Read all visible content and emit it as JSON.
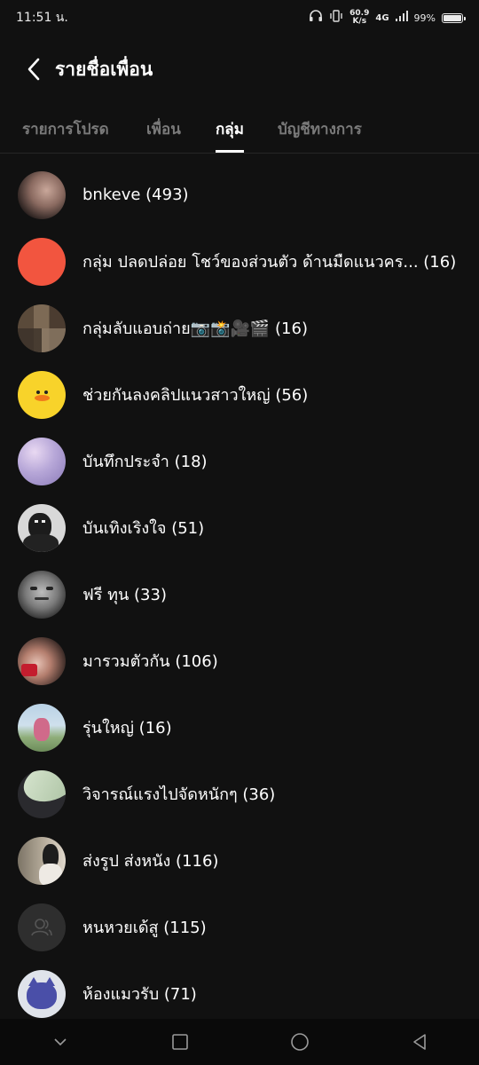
{
  "status_bar": {
    "time": "11:51 น.",
    "net_speed_value": "60.9",
    "net_speed_unit": "K/s",
    "network": "4G",
    "battery_percent": "99%",
    "battery_level": 0.99,
    "icons": [
      "headphones-icon",
      "vibrate-icon",
      "signal-icon",
      "battery-icon"
    ]
  },
  "header": {
    "title": "รายชื่อเพื่อน"
  },
  "tabs": [
    {
      "label": "รายการโปรด",
      "active": false
    },
    {
      "label": "เพื่อน",
      "active": false
    },
    {
      "label": "กลุ่ม",
      "active": true
    },
    {
      "label": "บัญชีทางการ",
      "active": false
    }
  ],
  "groups": [
    {
      "label": "bnkeve (493)"
    },
    {
      "label": "กลุ่ม ปลดปล่อย โชว์ของส่วนตัว ด้านมืดแนวคร... (16)"
    },
    {
      "label": "กลุ่มลับแอบถ่าย📷📸🎥🎬 (16)"
    },
    {
      "label": "ช่วยกันลงคลิปแนวสาวใหญ่ (56)"
    },
    {
      "label": "บันทึกประจำ (18)"
    },
    {
      "label": "บันเทิงเริงใจ (51)"
    },
    {
      "label": "ฟรี ทุน (33)"
    },
    {
      "label": "มารวมตัวกัน (106)"
    },
    {
      "label": "รุ่นใหญ่ (16)"
    },
    {
      "label": "วิจารณ์แรงไปจัดหนักๆ (36)"
    },
    {
      "label": "ส่งรูป ส่งหนัง (116)"
    },
    {
      "label": "หนหวยเด้สู (115)"
    },
    {
      "label": "ห้องแมวรับ (71)"
    }
  ],
  "colors": {
    "background": "#111111",
    "text": "#ffffff",
    "tab_inactive": "#7a7a7a",
    "accent_group_avatar": "#f2553f",
    "duck_avatar": "#f8d32a"
  }
}
